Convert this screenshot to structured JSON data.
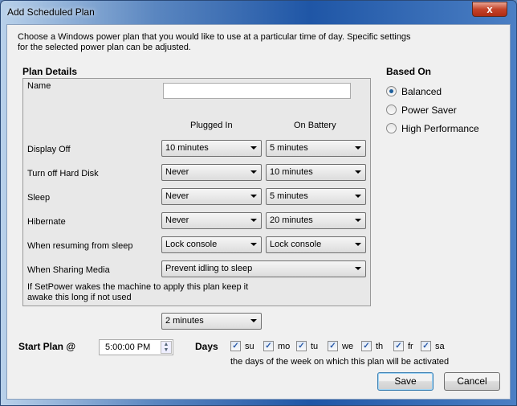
{
  "window": {
    "title": "Add Scheduled Plan",
    "close": "x"
  },
  "intro": [
    "Choose a Windows power plan that you would like to use at a particular time of day.  Specific settings",
    "for the selected power plan can be adjusted."
  ],
  "plan_details": {
    "heading": "Plan Details",
    "name_label": "Name",
    "name_value": "",
    "col_plugged": "Plugged In",
    "col_battery": "On Battery",
    "rows": [
      {
        "label": "Display Off",
        "plugged": "10 minutes",
        "battery": "5 minutes"
      },
      {
        "label": "Turn off Hard Disk",
        "plugged": "Never",
        "battery": "10 minutes"
      },
      {
        "label": "Sleep",
        "plugged": "Never",
        "battery": "5 minutes"
      },
      {
        "label": "Hibernate",
        "plugged": "Never",
        "battery": "20 minutes"
      },
      {
        "label": "When resuming from sleep",
        "plugged": "Lock console",
        "battery": "Lock console"
      }
    ],
    "sharing_label": "When Sharing Media",
    "sharing_value": "Prevent idling to sleep",
    "wake_text": [
      "If SetPower wakes the machine to apply this plan keep it",
      "awake this long if not used"
    ],
    "wake_value": "2 minutes"
  },
  "based_on": {
    "heading": "Based On",
    "options": [
      {
        "label": "Balanced",
        "selected": true
      },
      {
        "label": "Power Saver",
        "selected": false
      },
      {
        "label": "High Performance",
        "selected": false
      }
    ]
  },
  "start": {
    "label": "Start Plan @",
    "time": "5:00:00 PM"
  },
  "days": {
    "label": "Days",
    "items": [
      {
        "label": "su",
        "checked": true
      },
      {
        "label": "mo",
        "checked": true
      },
      {
        "label": "tu",
        "checked": true
      },
      {
        "label": "we",
        "checked": true
      },
      {
        "label": "th",
        "checked": true
      },
      {
        "label": "fr",
        "checked": true
      },
      {
        "label": "sa",
        "checked": true
      }
    ],
    "hint": "the days of the week on which this plan will be activated"
  },
  "buttons": {
    "save": "Save",
    "cancel": "Cancel"
  },
  "colors": {
    "radio_selected": "#1d5f9c",
    "check": "#2a5aa8"
  }
}
